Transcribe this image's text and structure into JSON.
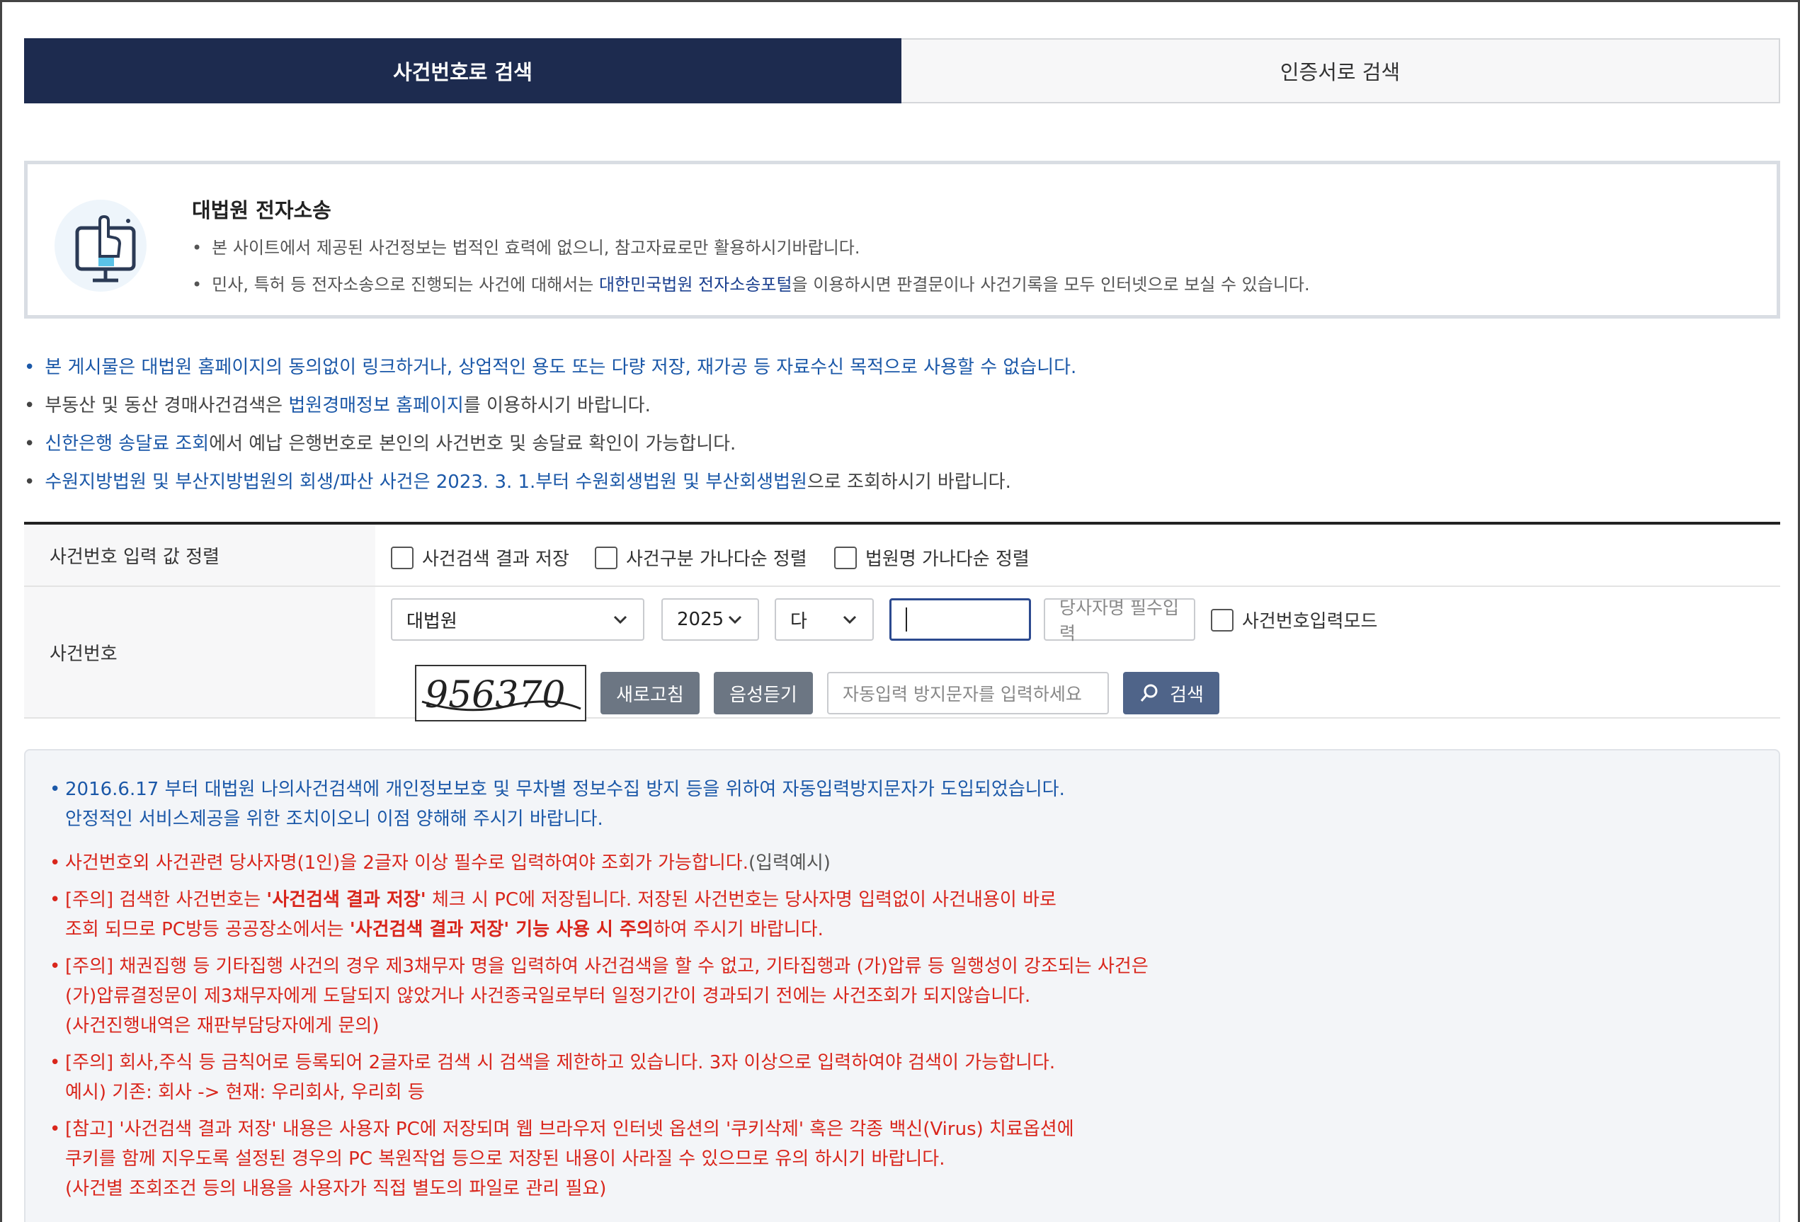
{
  "tabs": {
    "case_number": "사건번호로 검색",
    "certificate": "인증서로 검색"
  },
  "notice": {
    "title": "대법원 전자소송",
    "line1": "본 사이트에서 제공된 사건정보는 법적인 효력에 없으니, 참고자료로만 활용하시기바랍니다.",
    "line2_pre": "민사, 특허 등 전자소송으로 진행되는 사건에 대해서는 ",
    "line2_link": "대한민국법원 전자소송포털",
    "line2_post": "을 이용하시면 판결문이나 사건기록을 모두 인터넷으로 보실 수 있습니다."
  },
  "info": {
    "line1": "본 게시물은 대법원 홈페이지의 동의없이 링크하거나, 상업적인 용도 또는 다량 저장, 재가공 등 자료수신 목적으로 사용할 수 없습니다.",
    "line2_pre": "부동산 및 동산 경매사건검색은 ",
    "line2_link": "법원경매정보 홈페이지",
    "line2_post": "를 이용하시기 바랍니다.",
    "line3_link": "신한은행 송달료 조회",
    "line3_post": "에서 예납 은행번호로 본인의 사건번호 및 송달료 확인이 가능합니다.",
    "line4_link": "수원지방법원 및 부산지방법원의 회생/파산 사건은 2023. 3. 1.부터 수원회생법원 및 부산회생법원",
    "line4_post": "으로 조회하시기 바랍니다."
  },
  "form": {
    "row1_label": "사건번호 입력 값 정렬",
    "chk_save": "사건검색 결과 저장",
    "chk_type_sort": "사건구분 가나다순 정렬",
    "chk_court_sort": "법원명 가나다순 정렬",
    "row2_label": "사건번호",
    "court_value": "대법원",
    "year_value": "2025",
    "type_value": "다",
    "party_placeholder": "당사자명 필수입력",
    "chk_input_mode": "사건번호입력모드",
    "captcha_text": "956370",
    "refresh_label": "새로고침",
    "audio_label": "음성듣기",
    "captcha_placeholder": "자동입력 방지문자를 입력하세요",
    "search_label": "검색"
  },
  "notes": {
    "n1a": "2016.6.17 부터 대법원 나의사건검색에 개인정보보호 및 무차별 정보수집 방지 등을 위하여 자동입력방지문자가 도입되었습니다.",
    "n1b": "안정적인 서비스제공을 위한 조치이오니 이점 양해해 주시기 바랍니다.",
    "n2": "사건번호외 사건관련 당사자명(1인)을 2글자 이상 필수로 입력하여야 조회가 가능합니다.",
    "n2_tail": "(입력예시)",
    "n3a_pre": "[주의] 검색한 사건번호는 ",
    "n3a_bold": "'사건검색 결과 저장'",
    "n3a_post": " 체크 시 PC에 저장됩니다. 저장된 사건번호는 당사자명 입력없이 사건내용이 바로",
    "n3b_pre": "조회 되므로 PC방등 공공장소에서는 ",
    "n3b_bold": "'사건검색 결과 저장' 기능 사용 시 주의",
    "n3b_post": "하여 주시기 바랍니다.",
    "n4a": "[주의] 채권집행 등 기타집행 사건의 경우 제3채무자 명을 입력하여 사건검색을 할 수 없고, 기타집행과 (가)압류 등 일행성이 강조되는 사건은",
    "n4b": "(가)압류결정문이 제3채무자에게 도달되지 않았거나 사건종국일로부터 일정기간이 경과되기 전에는 사건조회가 되지않습니다.",
    "n4c": "(사건진행내역은 재판부담당자에게 문의)",
    "n5a": "[주의] 회사,주식 등 금칙어로 등록되어 2글자로 검색 시 검색을 제한하고 있습니다. 3자 이상으로 입력하여야 검색이 가능합니다.",
    "n5b": "예시) 기존: 회사 -> 현재: 우리회사, 우리회 등",
    "n6a": "[참고] '사건검색 결과 저장' 내용은 사용자 PC에 저장되며 웹 브라우저 인터넷 옵션의 '쿠키삭제' 혹은 각종 백신(Virus) 치료옵션에",
    "n6b": "쿠키를 함께 지우도록 설정된 경우의 PC 복원작업 등으로 저장된 내용이 사라질 수 있으므로 유의 하시기 바랍니다.",
    "n6c": "(사건별 조회조건 등의 내용을 사용자가 직접 별도의 파일로 관리 필요)"
  },
  "colors": {
    "active_tab": "#1d2b4f",
    "link_blue": "#1b58a8",
    "warning_red": "#d9261c",
    "button_gray": "#6c7683",
    "search_button": "#4f6489"
  },
  "icons": {
    "notice": "touch-monitor-icon",
    "select": "chevron-down-icon",
    "search": "magnifier-icon"
  }
}
